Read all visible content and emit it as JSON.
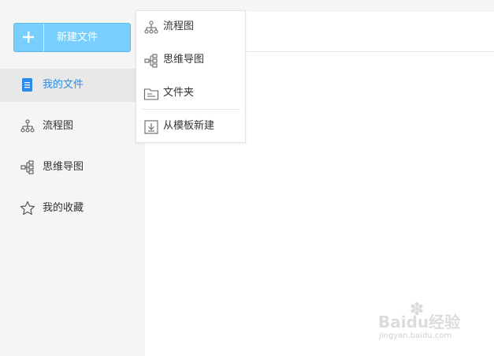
{
  "new_button": {
    "label": "新建文件",
    "icon": "plus-icon"
  },
  "sidebar": {
    "items": [
      {
        "label": "我的文件",
        "icon": "file-icon",
        "active": true
      },
      {
        "label": "流程图",
        "icon": "flowchart-icon",
        "active": false
      },
      {
        "label": "思维导图",
        "icon": "mindmap-icon",
        "active": false
      },
      {
        "label": "我的收藏",
        "icon": "star-icon",
        "active": false
      }
    ]
  },
  "dropdown": {
    "items": [
      {
        "label": "流程图",
        "icon": "flowchart-icon"
      },
      {
        "label": "思维导图",
        "icon": "mindmap-icon"
      },
      {
        "label": "文件夹",
        "icon": "folder-icon"
      },
      {
        "label": "从模板新建",
        "icon": "template-icon"
      }
    ]
  },
  "watermark": {
    "logo": "Baidu经验",
    "url": "jingyan.baidu.com"
  },
  "colors": {
    "accent": "#2b8ce8",
    "button_bg": "#78cffd",
    "sidebar_bg": "#f5f5f5",
    "active_bg": "#e8e8e8"
  }
}
